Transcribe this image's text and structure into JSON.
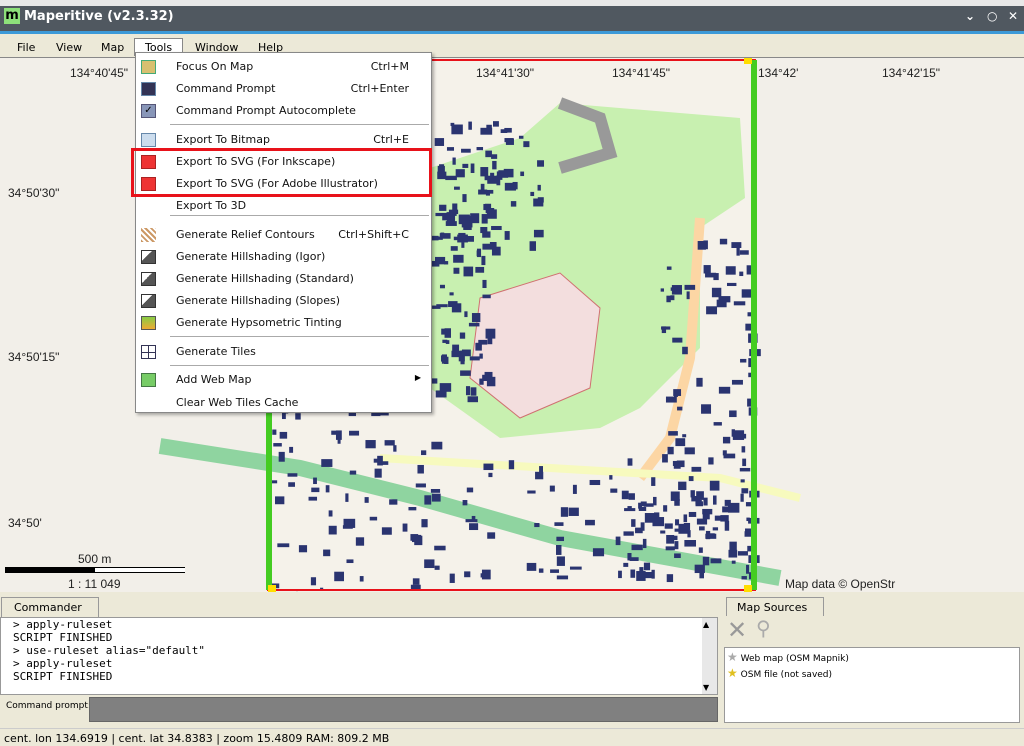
{
  "window": {
    "title": "Maperitive (v2.3.32)",
    "logo": "m"
  },
  "menubar": [
    "File",
    "View",
    "Map",
    "Tools",
    "Window",
    "Help"
  ],
  "tools_menu": [
    {
      "label": "Focus On Map",
      "shortcut": "Ctrl+M",
      "icon": "map-icon"
    },
    {
      "label": "Command Prompt",
      "shortcut": "Ctrl+Enter",
      "icon": "console-icon"
    },
    {
      "label": "Command Prompt Autocomplete",
      "shortcut": "",
      "icon": "check-icon",
      "checked": true
    },
    {
      "label": "Export To Bitmap",
      "shortcut": "Ctrl+E",
      "icon": "bitmap-icon"
    },
    {
      "label": "Export To SVG (For Inkscape)",
      "shortcut": "",
      "icon": "svg-icon"
    },
    {
      "label": "Export To SVG (For Adobe Illustrator)",
      "shortcut": "",
      "icon": "svg-icon"
    },
    {
      "label": "Export To 3D",
      "shortcut": "",
      "icon": ""
    },
    {
      "label": "Generate Relief Contours",
      "shortcut": "Ctrl+Shift+C",
      "icon": "contours-icon"
    },
    {
      "label": "Generate Hillshading (Igor)",
      "shortcut": "",
      "icon": "hillshade-icon"
    },
    {
      "label": "Generate Hillshading (Standard)",
      "shortcut": "",
      "icon": "hillshade-icon"
    },
    {
      "label": "Generate Hillshading (Slopes)",
      "shortcut": "",
      "icon": "hillshade-icon"
    },
    {
      "label": "Generate Hypsometric Tinting",
      "shortcut": "",
      "icon": "tinting-icon"
    },
    {
      "label": "Generate Tiles",
      "shortcut": "",
      "icon": "tiles-icon"
    },
    {
      "label": "Add Web Map",
      "shortcut": "",
      "icon": "add-web-map-icon",
      "submenu": true
    },
    {
      "label": "Clear Web Tiles Cache",
      "shortcut": "",
      "icon": ""
    }
  ],
  "map": {
    "lon_labels": [
      "134°40'45\"",
      "134°41'30\"",
      "134°41'45\"",
      "134°42'",
      "134°42'15\""
    ],
    "lat_labels": [
      "34°50'30\"",
      "34°50'15\"",
      "34°50'"
    ],
    "scale_label": "500 m",
    "scale_ratio": "1 : 11 049",
    "attribution": "Map data © OpenStr"
  },
  "commander": {
    "tab": "Commander",
    "lines": [
      "> apply-ruleset",
      "SCRIPT FINISHED",
      "> use-ruleset alias=\"default\"",
      "> apply-ruleset",
      "SCRIPT FINISHED"
    ],
    "prompt_label": "Command prompt:",
    "prompt_value": ""
  },
  "map_sources": {
    "tab": "Map Sources",
    "items": [
      {
        "label": "Web map (OSM Mapnik)",
        "icon": "gray-star-icon"
      },
      {
        "label": "OSM file (not saved)",
        "icon": "gold-star-icon"
      }
    ]
  },
  "status": "cent. lon 134.6919 | cent. lat 34.8383 | zoom 15.4809   RAM: 809.2 MB",
  "colors": {
    "titlebar": "#505860",
    "accent": "#3c9ad8",
    "highlight": "#e8121a",
    "park": "#c8f0b0",
    "building": "#2a3470"
  }
}
